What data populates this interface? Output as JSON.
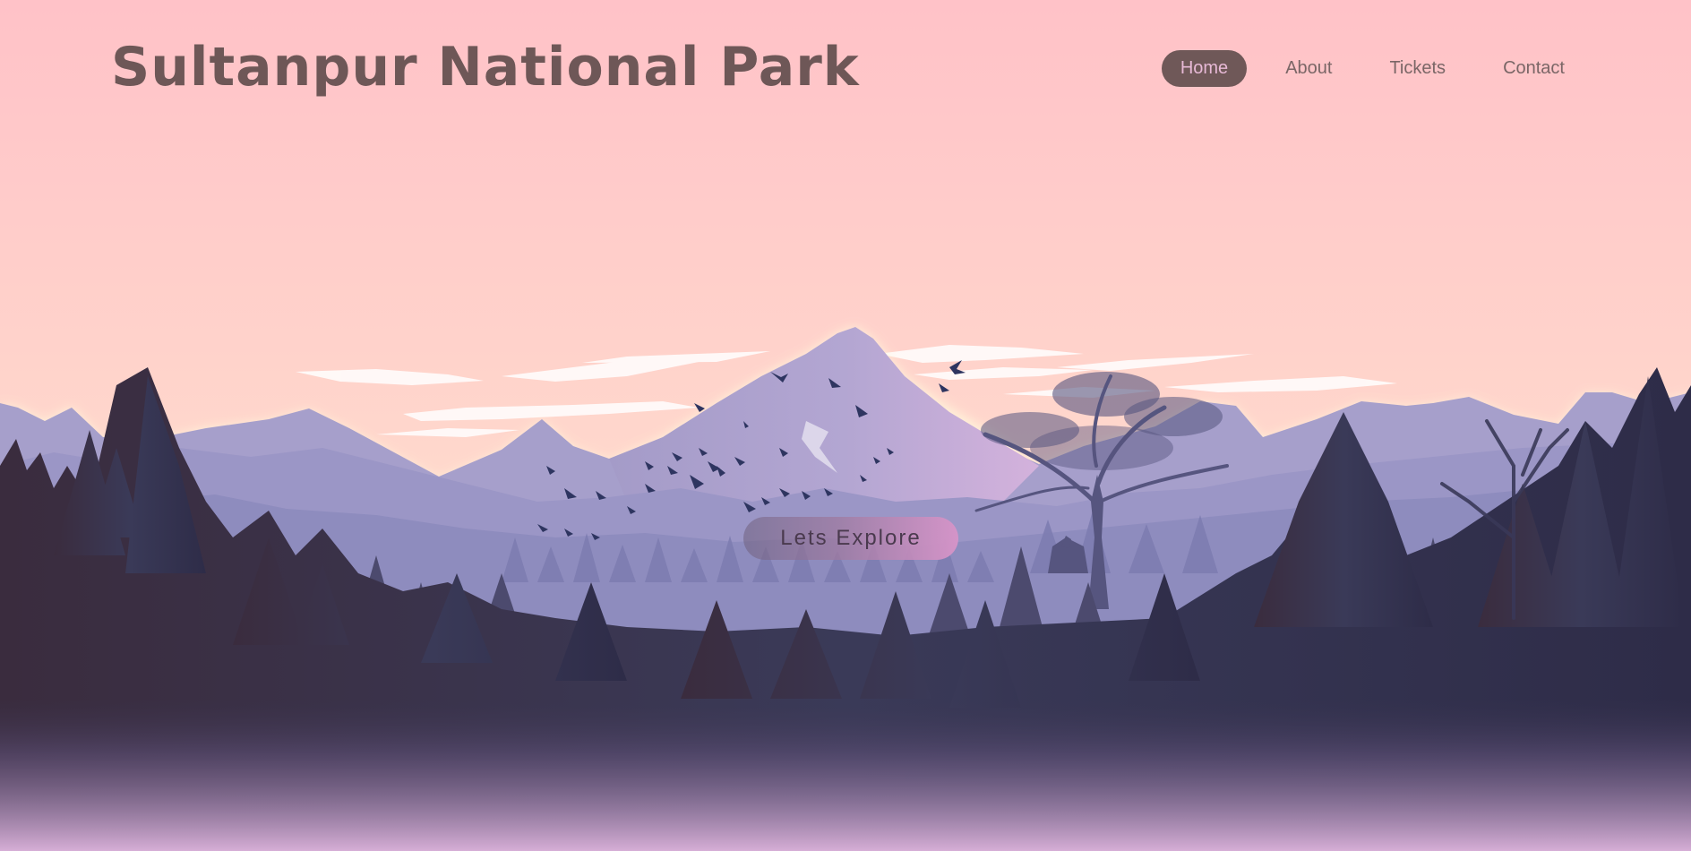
{
  "site": {
    "title": "Sultanpur National Park"
  },
  "nav": {
    "items": [
      {
        "label": "Home",
        "active": true
      },
      {
        "label": "About",
        "active": false
      },
      {
        "label": "Tickets",
        "active": false
      },
      {
        "label": "Contact",
        "active": false
      }
    ]
  },
  "hero": {
    "cta_label": "Lets Explore"
  },
  "colors": {
    "sky_top": "#ffc2c8",
    "sky_horizon": "#ffe3c8",
    "title": "#6e5757",
    "nav_text": "#7a6666",
    "nav_active_bg": "#6f5858",
    "nav_active_text": "#e7b9d6",
    "mountain_far": "#a7a0cc",
    "forest_dark": "#2e2a44",
    "mist_bottom": "#d6aed6",
    "cta_accent": "#d494c8"
  },
  "icons": {
    "scene": "mountain-forest-landscape-illustration",
    "birds": "flying-birds-icon"
  }
}
